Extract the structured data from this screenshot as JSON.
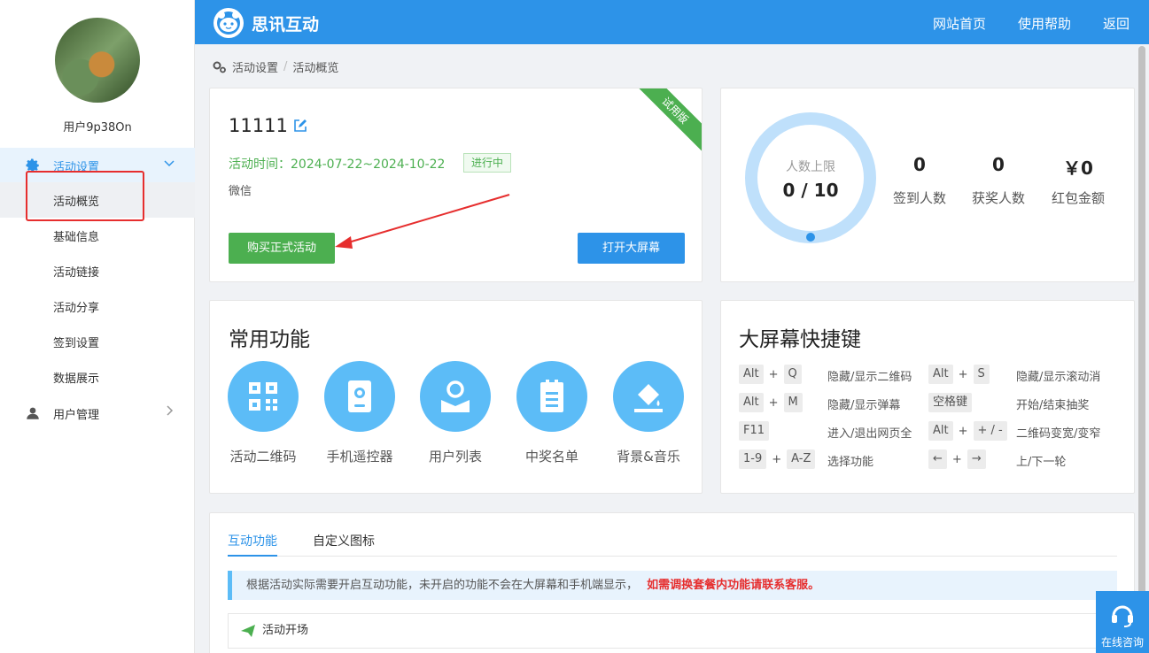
{
  "sidebar": {
    "username": "用户9p38On",
    "groups": [
      {
        "label": "活动设置",
        "expanded": true,
        "items": [
          "活动概览",
          "基础信息",
          "活动链接",
          "活动分享",
          "签到设置",
          "数据展示"
        ]
      },
      {
        "label": "用户管理",
        "expanded": false
      }
    ],
    "active_item": "活动概览"
  },
  "topbar": {
    "brand": "思讯互动",
    "links": [
      "网站首页",
      "使用帮助",
      "返回"
    ]
  },
  "breadcrumb": [
    "活动设置",
    "活动概览"
  ],
  "activity": {
    "name": "11111",
    "time_label": "活动时间：2024-07-22~2024-10-22",
    "status": "进行中",
    "platform": "微信",
    "buy_button": "购买正式活动",
    "screen_button": "打开大屏幕",
    "ribbon": "试用版"
  },
  "stats": {
    "ring_title": "人数上限",
    "ring_value": "0 / 10",
    "ring_fill": 0,
    "items": [
      {
        "value": "0",
        "label": "签到人数"
      },
      {
        "value": "0",
        "label": "获奖人数"
      },
      {
        "value": "￥0",
        "label": "红包金额"
      }
    ]
  },
  "common": {
    "title": "常用功能",
    "items": [
      {
        "label": "活动二维码",
        "icon": "qrcode-icon"
      },
      {
        "label": "手机遥控器",
        "icon": "remote-icon"
      },
      {
        "label": "用户列表",
        "icon": "user-list-icon"
      },
      {
        "label": "中奖名单",
        "icon": "clipboard-icon"
      },
      {
        "label": "背景&音乐",
        "icon": "paint-bucket-icon"
      }
    ]
  },
  "shortcuts": {
    "title": "大屏幕快捷键",
    "rows": [
      {
        "l_keys": [
          "Alt",
          "Q"
        ],
        "l_desc": "隐藏/显示二维码",
        "r_keys": [
          "Alt",
          "S"
        ],
        "r_desc": "隐藏/显示滚动消"
      },
      {
        "l_keys": [
          "Alt",
          "M"
        ],
        "l_desc": "隐藏/显示弹幕",
        "r_keys": [
          "空格键"
        ],
        "r_desc": "开始/结束抽奖"
      },
      {
        "l_keys": [
          "F11"
        ],
        "l_desc": "进入/退出网页全",
        "r_keys": [
          "Alt",
          "+ / -"
        ],
        "r_desc": "二维码变宽/变窄"
      },
      {
        "l_keys": [
          "1-9",
          "A-Z"
        ],
        "l_desc": "选择功能",
        "r_keys": [
          "←",
          "→"
        ],
        "r_desc": "上/下一轮"
      }
    ],
    "plus": "+"
  },
  "interactive": {
    "tabs": [
      "互动功能",
      "自定义图标"
    ],
    "notice": "根据活动实际需要开启互动功能，未开启的功能不会在大屏幕和手机端显示，",
    "notice_highlight": "如需调换套餐内功能请联系客服。",
    "section": "活动开场"
  },
  "chat": {
    "label": "在线咨询"
  },
  "colors": {
    "primary": "#2d93e8",
    "green": "#4caf50",
    "light_blue": "#5cbcf7",
    "red": "#e62e2e"
  }
}
